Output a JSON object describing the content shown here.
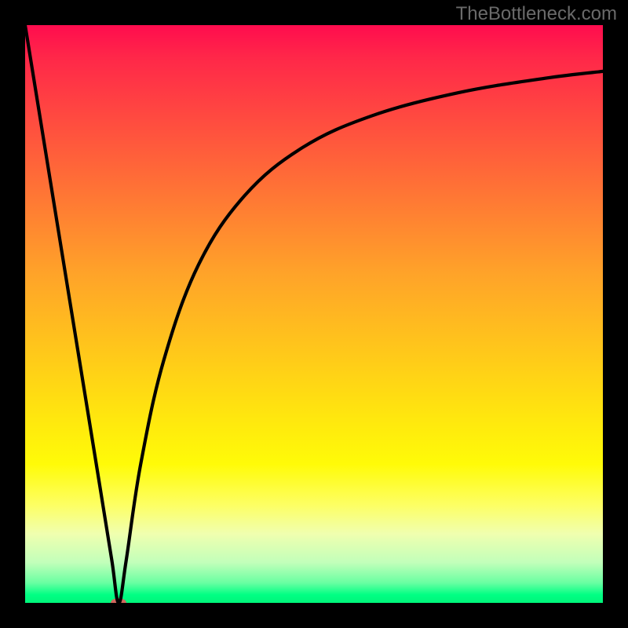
{
  "watermark": "TheBottleneck.com",
  "colors": {
    "curve_stroke": "#000000",
    "marker": "#d1675e",
    "page_bg": "#000000",
    "gradient_top": "#ff0c4e",
    "gradient_mid": "#ffe70e",
    "gradient_bottom": "#00f57a"
  },
  "chart_data": {
    "type": "line",
    "title": "",
    "xlabel": "",
    "ylabel": "",
    "xlim": [
      0,
      100
    ],
    "ylim": [
      0,
      100
    ],
    "grid": false,
    "legend": null,
    "series": [
      {
        "name": "bottleneck-curve",
        "x": [
          0,
          5,
          10,
          13,
          15,
          16.2,
          17.5,
          20,
          24,
          30,
          38,
          48,
          60,
          75,
          90,
          100
        ],
        "values": [
          100,
          69.1,
          38.3,
          19.8,
          7.4,
          0,
          7.4,
          24.0,
          42.0,
          58.5,
          70.5,
          78.8,
          84.3,
          88.3,
          90.8,
          92.0
        ]
      }
    ],
    "annotations": [
      {
        "name": "min-marker",
        "x": 16.2,
        "y": 0
      }
    ],
    "notes": "x-axis is unlabeled horizontal position (0=left, 100=right of plot area). y-axis is unlabeled vertical value (0 at bottom green band, 100 at top of plot). Curve shows a sharp V-shaped dip reaching 0 near x≈16 then asymptotically rising toward ~92 at the right edge. Values estimated from pixel positions."
  }
}
